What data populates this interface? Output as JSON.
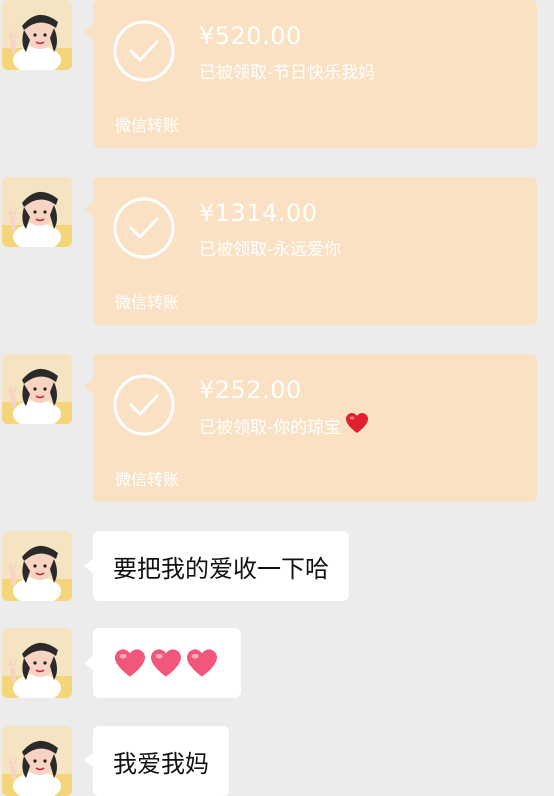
{
  "transfers": [
    {
      "amount": "¥520.00",
      "status": "已被领取-节日快乐我妈",
      "footer": "微信转账"
    },
    {
      "amount": "¥1314.00",
      "status": "已被领取-永远爱你",
      "footer": "微信转账"
    },
    {
      "amount": "¥252.00",
      "status": "已被领取-你的琼宝",
      "footer": "微信转账",
      "emoji": "red-heart-icon"
    }
  ],
  "messages": [
    {
      "text": "要把我的爱收一下哈"
    },
    {
      "emoji": [
        "pink-heart-icon",
        "pink-heart-icon",
        "pink-heart-icon"
      ]
    },
    {
      "text": "我爱我妈"
    }
  ],
  "colors": {
    "background": "#ececec",
    "transfer_bubble": "#fbe1c4",
    "text_bubble": "#ffffff",
    "red_heart": "#e0202c",
    "pink_heart": "#f0577a"
  }
}
